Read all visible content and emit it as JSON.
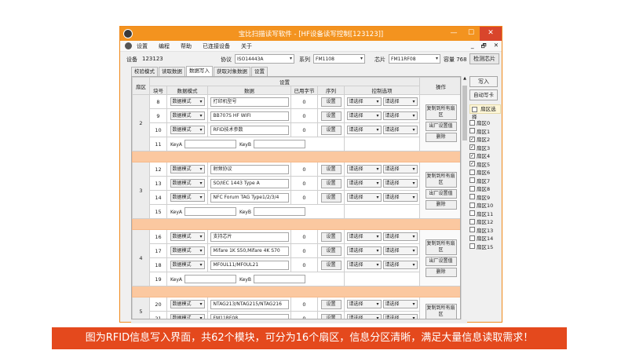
{
  "window": {
    "title": "宝比扫描读写软件 - [HF设备读写控制[123123]]",
    "controls": {
      "minimize": "—",
      "maximize": "☐",
      "close": "✕"
    },
    "mdi_controls": {
      "minimize": "_",
      "restore": "🗗",
      "close": "✕"
    }
  },
  "menu": {
    "items": [
      "设置",
      "编程",
      "帮助",
      "已连接设备",
      "关于"
    ]
  },
  "device_bar": {
    "device_label": "设备",
    "device_value": "123123",
    "protocol_label": "协议",
    "protocol_value": "ISO14443A",
    "series_label": "系列",
    "series_value": "FM1108",
    "chip_label": "芯片",
    "chip_value": "FM11RF08",
    "capacity_label": "容量 768",
    "check_chip": "检测芯片"
  },
  "tabs": [
    "校验模式",
    "读取数据",
    "数据写入",
    "获取对象数据",
    "设置"
  ],
  "active_tab": 2,
  "grid": {
    "header": {
      "sector": "扇区",
      "settings": "设置",
      "operation": "操作",
      "block": "块号",
      "data_mode": "数据模式",
      "data": "数据",
      "used_bytes": "已用字节",
      "sequence": "序列",
      "control": "控制选项"
    },
    "mode_value": "数据模式",
    "set_label": "设置",
    "select_label": "请选择",
    "keyA_label": "KeyA",
    "keyB_label": "KeyB",
    "op_copy": "复制到所有扇区",
    "op_factory": "出厂设置值",
    "op_delete": "删除",
    "sectors": [
      {
        "sector": "2",
        "rows": [
          {
            "block": "8",
            "data": "打印机型号",
            "used": "0"
          },
          {
            "block": "9",
            "data": "BB707S HF WIFI",
            "used": "0"
          },
          {
            "block": "10",
            "data": "RFID技术参数",
            "used": "0"
          }
        ],
        "key_block": "11"
      },
      {
        "sector": "3",
        "rows": [
          {
            "block": "12",
            "data": "射频协议",
            "used": "0"
          },
          {
            "block": "13",
            "data": "SO/IEC 1443 Type A",
            "used": "0"
          },
          {
            "block": "14",
            "data": "NFC Forum TAG Type1/2/3/4",
            "used": "0"
          }
        ],
        "key_block": "15"
      },
      {
        "sector": "4",
        "rows": [
          {
            "block": "16",
            "data": "支持芯片",
            "used": "0"
          },
          {
            "block": "17",
            "data": "Mifare 1K S50,Mifare 4K S70",
            "used": "0"
          },
          {
            "block": "18",
            "data": "MF0UL11/MF0UL21",
            "used": "0"
          }
        ],
        "key_block": "19"
      },
      {
        "sector": "5",
        "rows": [
          {
            "block": "20",
            "data": "NTAG213/NTAG215/NTAG216",
            "used": "0"
          },
          {
            "block": "21",
            "data": "FM11RF08",
            "used": "0"
          }
        ]
      }
    ]
  },
  "side_panel": {
    "write": "写入",
    "auto_write": "自动写卡",
    "sector_select": "扇区选择",
    "sectors": [
      {
        "label": "扇区0",
        "checked": false
      },
      {
        "label": "扇区1",
        "checked": false
      },
      {
        "label": "扇区2",
        "checked": true
      },
      {
        "label": "扇区3",
        "checked": true
      },
      {
        "label": "扇区4",
        "checked": true
      },
      {
        "label": "扇区5",
        "checked": true
      },
      {
        "label": "扇区6",
        "checked": false
      },
      {
        "label": "扇区7",
        "checked": false
      },
      {
        "label": "扇区8",
        "checked": false
      },
      {
        "label": "扇区9",
        "checked": false
      },
      {
        "label": "扇区10",
        "checked": false
      },
      {
        "label": "扇区11",
        "checked": false
      },
      {
        "label": "扇区12",
        "checked": false
      },
      {
        "label": "扇区13",
        "checked": false
      },
      {
        "label": "扇区14",
        "checked": false
      },
      {
        "label": "扇区15",
        "checked": false
      }
    ]
  },
  "banner": "图为RFID信息写入界面，共62个模块，可分为16个扇区，信息分区清晰，满足大量信息读取需求！",
  "colors": {
    "accent": "#f3931f",
    "separator": "#fbc8a0",
    "banner": "#e4491d"
  }
}
